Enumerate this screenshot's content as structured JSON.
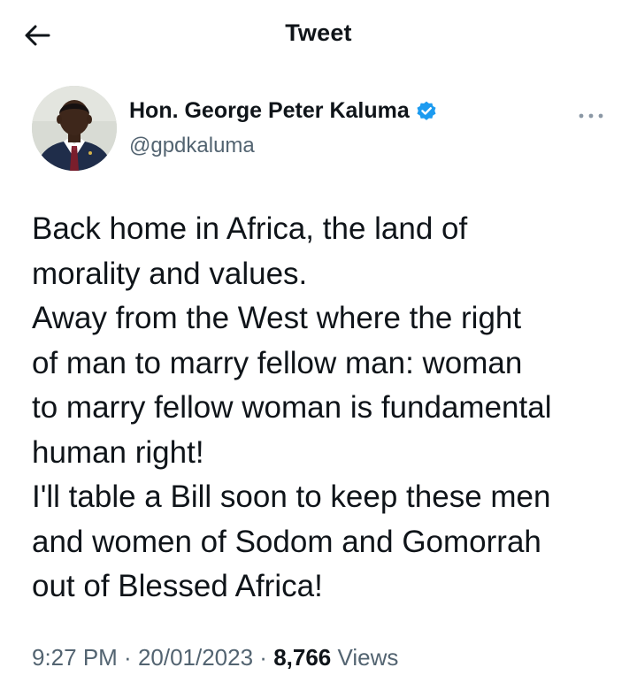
{
  "header": {
    "title": "Tweet",
    "back_icon": "arrow-left-icon"
  },
  "author": {
    "display_name": "Hon. George Peter Kaluma",
    "handle": "@gpdkaluma",
    "verified": true,
    "verified_color": "#1d9bf0",
    "avatar_icon": "profile-photo",
    "more_icon": "more-horizontal-icon"
  },
  "tweet": {
    "lines": [
      "Back home in Africa, the land of",
      "morality and values.",
      "Away from the West where the right",
      "of man to marry fellow man: woman",
      "to marry fellow woman is fundamental",
      "human right!",
      "I'll table a Bill soon to keep these men",
      "and women of Sodom and Gomorrah",
      "out of Blessed Africa!"
    ]
  },
  "meta": {
    "time": "9:27 PM",
    "separator": " · ",
    "date": "20/01/2023",
    "views_count": "8,766",
    "views_label": " Views"
  },
  "colors": {
    "text_primary": "#0f1419",
    "text_secondary": "#536471",
    "background": "#ffffff"
  }
}
